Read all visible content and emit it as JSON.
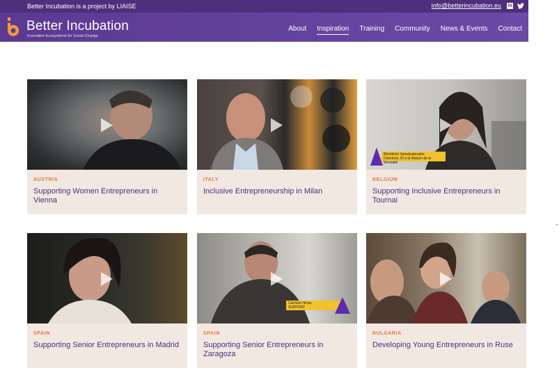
{
  "topbar": {
    "left_text": "Better Incubation is a project by LIAISE",
    "email": "info@betterincubation.eu",
    "social_icons": [
      "linkedin-icon",
      "twitter-icon"
    ]
  },
  "header": {
    "brand": "Better Incubation",
    "tagline": "Innovation Ecosystems for Social Change",
    "logo_glyph": "b",
    "nav": [
      {
        "label": "About"
      },
      {
        "label": "Inspiration",
        "active": true
      },
      {
        "label": "Training"
      },
      {
        "label": "Community"
      },
      {
        "label": "News & Events"
      },
      {
        "label": "Contact"
      }
    ]
  },
  "colors": {
    "brand_purple": "#5b3991",
    "accent_orange": "#e8733a",
    "card_bg": "#f1e8e2",
    "title_purple": "#4d2f7d"
  },
  "cards": [
    {
      "country": "AUSTRIA",
      "title": "Supporting Women Entrepreneurs in Vienna"
    },
    {
      "country": "ITALY",
      "title": "Inclusive Entrepreneurship in Milan"
    },
    {
      "country": "BELGIUM",
      "title": "Supporting Inclusive Entrepreneurs in Tournai",
      "overlay_name": "Bénédicte Vanwijnsberghe",
      "overlay_role": "Directrice, ID à la Maison de la Mentalité"
    },
    {
      "country": "SPAIN",
      "title": "Supporting Senior Entrepreneurs in Madrid"
    },
    {
      "country": "SPAIN",
      "title": "Supporting Senior Entrepreneurs in Zaragoza",
      "overlay_name": "Carmelo Heras",
      "overlay_role": "SUPPORT"
    },
    {
      "country": "BULGARIA",
      "title": "Developing Young Entrepreneurs in Ruse"
    }
  ]
}
